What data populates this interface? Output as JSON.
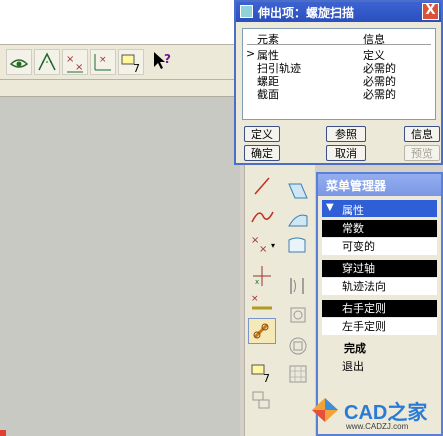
{
  "dialog": {
    "title": "伸出项：螺旋扫描",
    "close_label": "X",
    "columns": [
      "元素",
      "信息"
    ],
    "rows": [
      {
        "element": "属性",
        "info": "定义",
        "current": true
      },
      {
        "element": "扫引轨迹",
        "info": "必需的",
        "current": false
      },
      {
        "element": "螺距",
        "info": "必需的",
        "current": false
      },
      {
        "element": "截面",
        "info": "必需的",
        "current": false
      }
    ],
    "buttons": {
      "define": "定义",
      "reference": "参照",
      "info": "信息",
      "ok": "确定",
      "cancel": "取消",
      "preview": "预览"
    },
    "pointer_glyph": ">"
  },
  "menu_manager": {
    "title": "菜单管理器",
    "section": "属性",
    "items": [
      {
        "label": "常数",
        "selected": true
      },
      {
        "label": "可变的",
        "selected": false
      },
      {
        "label": "穿过轴",
        "selected": true
      },
      {
        "label": "轨迹法向",
        "selected": false
      },
      {
        "label": "右手定则",
        "selected": true
      },
      {
        "label": "左手定则",
        "selected": false
      }
    ],
    "done_label": "完成",
    "exit_label": "退出"
  },
  "watermark": {
    "text": "CAD之家",
    "url": "www.CADZJ.com"
  },
  "colors": {
    "title_blue": "#2a4fbf",
    "section_blue": "#2f5fd6",
    "background_gray": "#c9c9c4"
  }
}
